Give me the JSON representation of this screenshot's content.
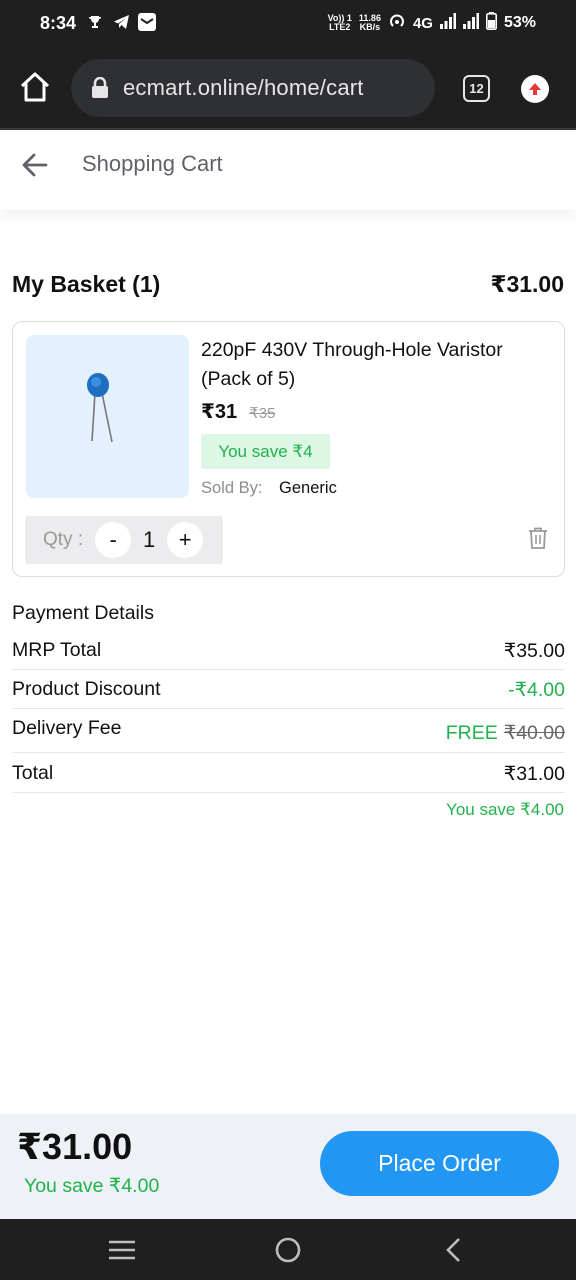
{
  "status_bar": {
    "time": "8:34",
    "net_top": "Vo)) 1",
    "net_bottom": "LTE2",
    "speed_top": "11.86",
    "speed_bottom": "KB/s",
    "network": "4G",
    "battery": "53%"
  },
  "browser": {
    "url": "ecmart.online/home/cart",
    "tab_count": "12"
  },
  "header": {
    "title": "Shopping Cart"
  },
  "basket": {
    "title": "My Basket (1)",
    "total": "₹31.00"
  },
  "cart_item": {
    "name": "220pF 430V Through-Hole Varistor (Pack of 5)",
    "price": "₹31",
    "mrp": "₹35",
    "save": "You save ₹4",
    "sold_by_label": "Sold By:",
    "sold_by_value": "Generic",
    "qty_label": "Qty :",
    "qty_minus": "-",
    "qty_value": "1",
    "qty_plus": "+"
  },
  "payment": {
    "title": "Payment Details",
    "rows": [
      {
        "label": "MRP Total",
        "value": "₹35.00"
      },
      {
        "label": "Product Discount",
        "value": "-₹4.00"
      },
      {
        "label": "Delivery Fee",
        "value": "FREE",
        "strike": "₹40.00"
      },
      {
        "label": "Total",
        "value": "₹31.00"
      }
    ],
    "save_note": "You save ₹4.00"
  },
  "bottom_bar": {
    "total": "₹31.00",
    "save": "You save ₹4.00",
    "place_order": "Place Order"
  },
  "colors": {
    "accent": "#2196f3",
    "success": "#22b24c",
    "dark_bar": "#1f1f1f"
  }
}
